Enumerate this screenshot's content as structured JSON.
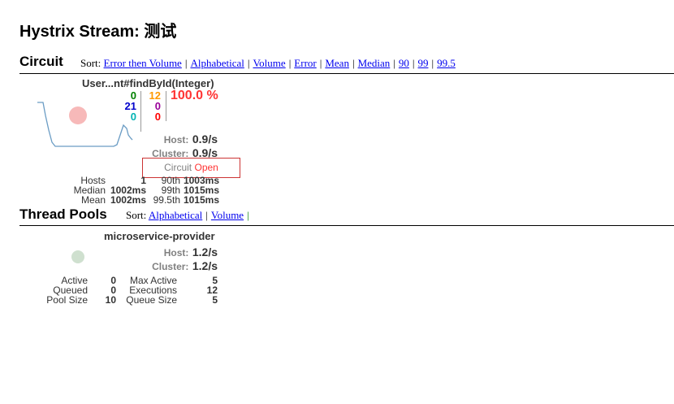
{
  "page_title": "Hystrix Stream: 测试",
  "circuit": {
    "heading": "Circuit",
    "sort_label": "Sort:",
    "sort_options": [
      "Error then Volume",
      "Alphabetical",
      "Volume",
      "Error",
      "Mean",
      "Median",
      "90",
      "99",
      "99.5"
    ],
    "name": "User...nt#findById(Integer)",
    "counts": {
      "success": "0",
      "short_circuited": "21",
      "bad_request": "0",
      "timeout": "12",
      "rejected": "0",
      "failure": "0"
    },
    "error_percentage": "100.0 %",
    "host_label": "Host:",
    "host_rate": "0.9/s",
    "cluster_label": "Cluster:",
    "cluster_rate": "0.9/s",
    "status_label": "Circuit",
    "status_value": "Open",
    "stats": {
      "hosts_label": "Hosts",
      "hosts_value": "1",
      "median_label": "Median",
      "median_value": "1002ms",
      "mean_label": "Mean",
      "mean_value": "1002ms",
      "p90_label": "90th",
      "p90_value": "1003ms",
      "p99_label": "99th",
      "p99_value": "1015ms",
      "p995_label": "99.5th",
      "p995_value": "1015ms"
    },
    "colors": {
      "success": "#008000",
      "short_circuited": "#0000cc",
      "bad_request": "#00b3b3",
      "timeout": "#ff9900",
      "rejected": "#990099",
      "failure": "#ff0000",
      "error_pct": "#ff3333",
      "bubble": "#f7b9b9",
      "sparkline": "#6a9cc4"
    }
  },
  "thread_pools": {
    "heading": "Thread Pools",
    "sort_label": "Sort:",
    "sort_options": [
      "Alphabetical",
      "Volume"
    ],
    "name": "microservice-provider",
    "host_label": "Host:",
    "host_rate": "1.2/s",
    "cluster_label": "Cluster:",
    "cluster_rate": "1.2/s",
    "stats": {
      "active_label": "Active",
      "active_value": "0",
      "queued_label": "Queued",
      "queued_value": "0",
      "pool_size_label": "Pool Size",
      "pool_size_value": "10",
      "max_active_label": "Max Active",
      "max_active_value": "5",
      "executions_label": "Executions",
      "executions_value": "12",
      "queue_size_label": "Queue Size",
      "queue_size_value": "5"
    },
    "colors": {
      "bubble": "#cfe0cf"
    }
  }
}
